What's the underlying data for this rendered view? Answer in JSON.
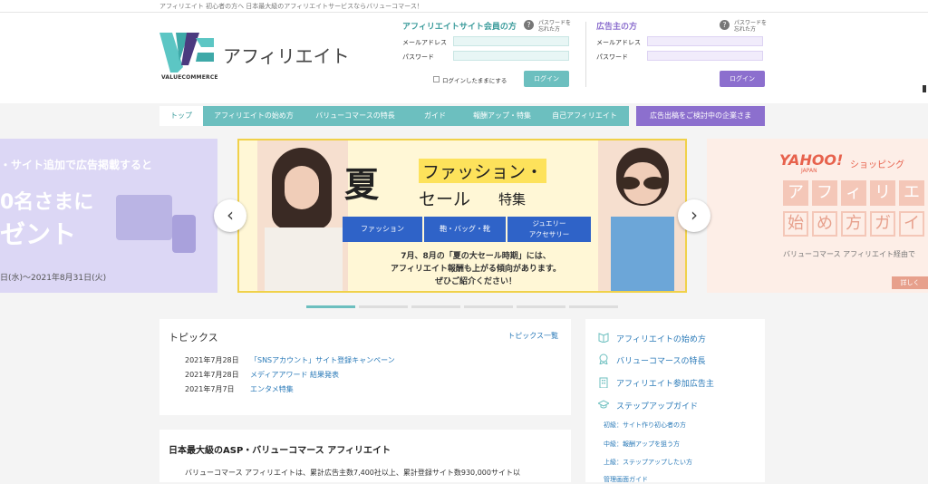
{
  "topbar": {
    "text": "アフィリエイト 初心者の方へ 日本最大級のアフィリエイトサービスならバリューコマース！"
  },
  "brand": {
    "logo_text": "VALUECOMMERCE",
    "title": "アフィリエイト"
  },
  "affiliate_login": {
    "title": "アフィリエイトサイト会員の方",
    "help": "パスワードを忘れた方",
    "email_label": "メールアドレス",
    "password_label": "パスワード",
    "email_value": "",
    "password_value": "",
    "remember_label": "ログインしたままにする",
    "button": "ログイン"
  },
  "advertiser_login": {
    "title": "広告主の方",
    "help": "パスワードを忘れた方",
    "email_label": "メールアドレス",
    "password_label": "パスワード",
    "email_value": "",
    "password_value": "",
    "button": "ログイン"
  },
  "nav": {
    "items": [
      "トップ",
      "アフィリエイトの始め方",
      "バリューコマースの特長",
      "ガイド",
      "報酬アップ・特集",
      "自己アフィリエイト"
    ],
    "advertiser": "広告出稿をご検討中の企業さま"
  },
  "carousel": {
    "left": {
      "line1": "・サイト追加で広告掲載すると",
      "line2": "0名さまに",
      "line3": "ゼント",
      "date": "日(水)～2021年8月31日(火)"
    },
    "main": {
      "big": "夏",
      "headline1": "ファッション・",
      "headline2": "セール",
      "headline3": "特集",
      "tags": [
        "ファッション",
        "鞄・バッグ・靴",
        "ジュエリー\nアクセサリー"
      ],
      "body1": "7月、8月の「夏の大セール時期」には、",
      "body2": "アフィリエイト報酬も上がる傾向があります。",
      "body3": "ぜひご紹介ください！"
    },
    "right": {
      "brand": "YAHOO!",
      "brand_sub": "JAPAN",
      "shop": "ショッピング",
      "row1": [
        "ア",
        "フ",
        "ィ",
        "リ",
        "エ"
      ],
      "row2": [
        "始",
        "め",
        "方",
        "ガ",
        "イ"
      ],
      "caption": "バリューコマース アフィリエイト経由で",
      "more": "詳しく"
    },
    "prev": "‹",
    "next": "›"
  },
  "topics": {
    "title": "トピックス",
    "all_link": "トピックス一覧",
    "items": [
      {
        "date": "2021年7月28日",
        "text": "「SNSアカウント」サイト登録キャンペーン"
      },
      {
        "date": "2021年7月28日",
        "text": "メディアアワード 結果発表"
      },
      {
        "date": "2021年7月7日",
        "text": "エンタメ特集"
      }
    ]
  },
  "sidebar": {
    "items": [
      "アフィリエイトの始め方",
      "バリューコマースの特長",
      "アフィリエイト参加広告主",
      "ステップアップガイド"
    ],
    "sub": [
      "初級：サイト作り初心者の方",
      "中級：報酬アップを狙う方",
      "上級：ステップアップしたい方",
      "管理画面ガイド"
    ]
  },
  "intro": {
    "title": "日本最大級のASP・バリューコマース アフィリエイト",
    "body": "バリューコマース アフィリエイトは、累計広告主数7,400社以上、累計登録サイト数930,000サイト以"
  },
  "colors": {
    "teal": "#6cbfbf",
    "purple": "#8c6fce",
    "link": "#2a7ab8"
  }
}
